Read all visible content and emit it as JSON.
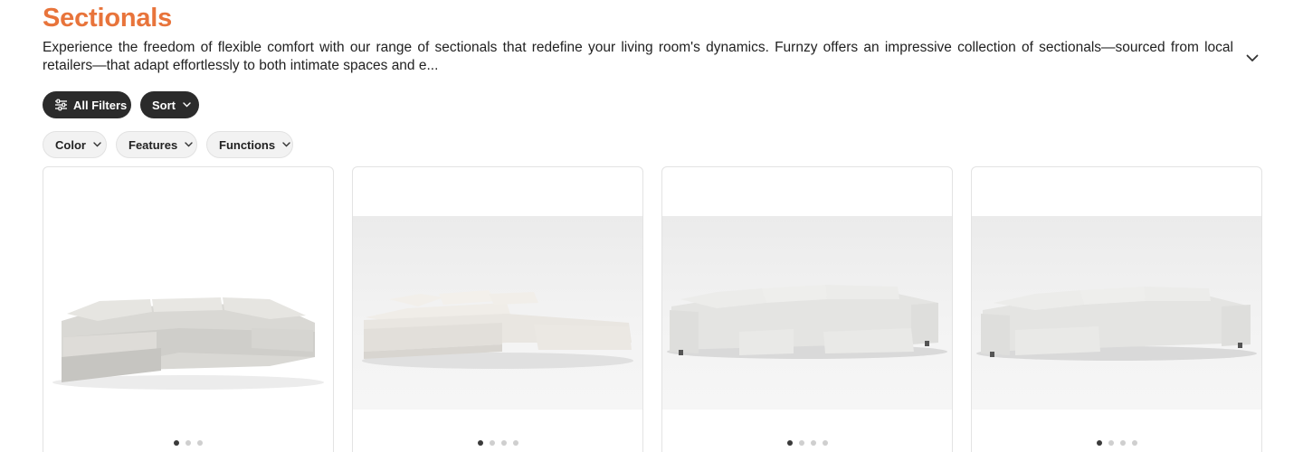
{
  "page": {
    "title": "Sectionals",
    "description": "Experience the freedom of flexible comfort with our range of sectionals that redefine your living room's dynamics. Furnzy offers an impressive collection of sectionals—sourced from local retailers—that adapt effortlessly to both intimate spaces and e..."
  },
  "toolbar": {
    "all_filters": "All Filters",
    "sort": "Sort"
  },
  "filters": [
    {
      "label": "Color"
    },
    {
      "label": "Features"
    },
    {
      "label": "Functions"
    }
  ],
  "products": [
    {
      "image": "modular-u-sectional-with-ottoman-light-gray",
      "carousel_dots": 3,
      "active_dot": 0
    },
    {
      "image": "modular-l-sectional-with-ottoman-cream",
      "carousel_dots": 4,
      "active_dot": 0
    },
    {
      "image": "u-sectional-with-storage-ottoman-light-gray",
      "carousel_dots": 4,
      "active_dot": 0
    },
    {
      "image": "u-sectional-with-chaise-ottoman-light-gray",
      "carousel_dots": 4,
      "active_dot": 0
    }
  ],
  "colors": {
    "title_accent": "#e8743b",
    "dark_pill": "#2b2b2b",
    "light_pill": "#f2f2f2"
  },
  "icons": {
    "expand": "chevron-down-icon",
    "filters": "sliders-icon",
    "dropdown": "chevron-down-icon"
  }
}
